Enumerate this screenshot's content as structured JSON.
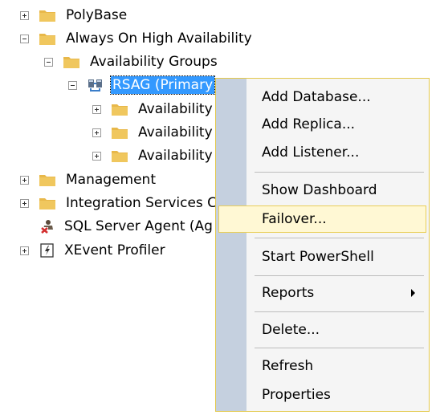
{
  "tree": {
    "items": [
      {
        "label": "PolyBase",
        "icon": "folder-icon",
        "expander": "plus"
      },
      {
        "label": "Always On High Availability",
        "icon": "folder-icon",
        "expander": "minus"
      },
      {
        "label": "Availability Groups",
        "icon": "folder-icon",
        "expander": "minus"
      },
      {
        "label": "RSAG (Primary",
        "icon": "availability-group-icon",
        "expander": "minus",
        "selected": true
      },
      {
        "label": "Availability",
        "icon": "folder-icon",
        "expander": "plus"
      },
      {
        "label": "Availability",
        "icon": "folder-icon",
        "expander": "plus"
      },
      {
        "label": "Availability",
        "icon": "folder-icon",
        "expander": "plus"
      },
      {
        "label": "Management",
        "icon": "folder-icon",
        "expander": "plus"
      },
      {
        "label": "Integration Services C",
        "icon": "folder-icon",
        "expander": "plus"
      },
      {
        "label": "SQL Server Agent (Ag",
        "icon": "sql-agent-stopped-icon",
        "expander": "none"
      },
      {
        "label": "XEvent Profiler",
        "icon": "xevent-profiler-icon",
        "expander": "plus"
      }
    ]
  },
  "context_menu": {
    "items": [
      {
        "label": "Add Database..."
      },
      {
        "label": "Add Replica..."
      },
      {
        "label": "Add Listener..."
      },
      {
        "label": "Show Dashboard"
      },
      {
        "label": "Failover...",
        "hovered": true
      },
      {
        "label": "Start PowerShell"
      },
      {
        "label": "Reports",
        "submenu": true
      },
      {
        "label": "Delete..."
      },
      {
        "label": "Refresh"
      },
      {
        "label": "Properties"
      }
    ]
  },
  "colors": {
    "folder": "#e8b84a",
    "selection": "#3399ff",
    "menu_gutter": "#c5d0df",
    "menu_hover": "#fff8d4",
    "menu_border": "#e3c84a"
  }
}
